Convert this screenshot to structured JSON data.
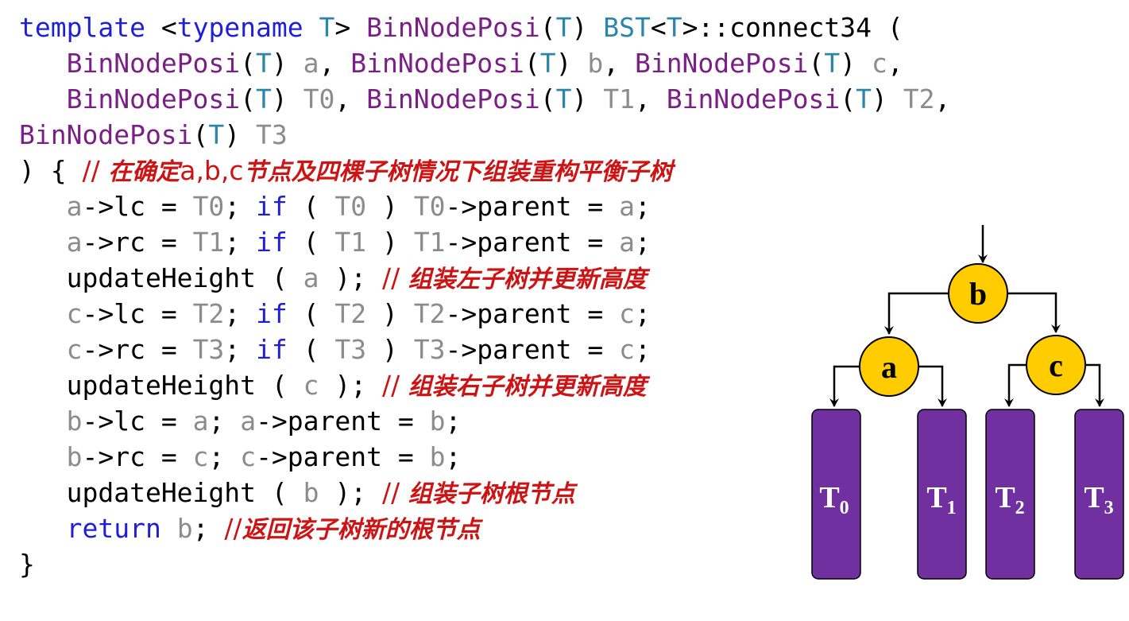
{
  "code": {
    "l1": {
      "kw_template": "template",
      "lt": " <",
      "kw_typename": "typename",
      "sp1": " ",
      "T1": "T",
      "gt": "> ",
      "binnodeposi": "BinNodePosi",
      "p_open": "(",
      "T2": "T",
      "p_close": ") ",
      "bst": "BST",
      "lt2": "<",
      "T3": "T",
      "rest": ">::connect34 ("
    },
    "l2": {
      "indent": "   ",
      "bnp1": "BinNodePosi",
      "po1": "(",
      "T1": "T",
      "pc1": ") ",
      "a": "a",
      "c1": ", ",
      "bnp2": "BinNodePosi",
      "po2": "(",
      "T2": "T",
      "pc2": ") ",
      "b": "b",
      "c2": ", ",
      "bnp3": "BinNodePosi",
      "po3": "(",
      "T3": "T",
      "pc3": ") ",
      "c": "c",
      "c3": ","
    },
    "l3": {
      "indent": "   ",
      "bnp1": "BinNodePosi",
      "po1": "(",
      "T1": "T",
      "pc1": ") ",
      "t0": "T0",
      "c1": ", ",
      "bnp2": "BinNodePosi",
      "po2": "(",
      "T2": "T",
      "pc2": ") ",
      "t1": "T1",
      "c2": ", ",
      "bnp3": "BinNodePosi",
      "po3": "(",
      "T3": "T",
      "pc3": ") ",
      "t2": "T2",
      "c3": ","
    },
    "l4": {
      "bnp": "BinNodePosi",
      "po": "(",
      "T": "T",
      "pc": ") ",
      "t3": "T3"
    },
    "l5": {
      "brace": ") { ",
      "comment_slash": "// ",
      "comment_cn1": "在确定",
      "comment_abc": "a,b,c",
      "comment_cn2": "节点及四棵子树情况下组装重构平衡子树"
    },
    "l6": {
      "indent": "   ",
      "a1": "a",
      "op": "->lc = ",
      "t0a": "T0",
      "semi": "; ",
      "kw_if": "if",
      "po": " ( ",
      "t0b": "T0",
      "pc": " ) ",
      "t0c": "T0",
      "assign": "->parent = ",
      "a2": "a",
      "end": ";"
    },
    "l7": {
      "indent": "   ",
      "a1": "a",
      "op": "->rc = ",
      "t1a": "T1",
      "semi": "; ",
      "kw_if": "if",
      "po": " ( ",
      "t1b": "T1",
      "pc": " ) ",
      "t1c": "T1",
      "assign": "->parent = ",
      "a2": "a",
      "end": ";"
    },
    "l8": {
      "indent": "   ",
      "fn": "updateHeight ( ",
      "a": "a",
      "close": " ); ",
      "slash": "// ",
      "comment": "组装左子树并更新高度"
    },
    "l9": {
      "indent": "   ",
      "c1": "c",
      "op": "->lc = ",
      "t2a": "T2",
      "semi": "; ",
      "kw_if": "if",
      "po": " ( ",
      "t2b": "T2",
      "pc": " ) ",
      "t2c": "T2",
      "assign": "->parent = ",
      "c2": "c",
      "end": ";"
    },
    "l10": {
      "indent": "   ",
      "c1": "c",
      "op": "->rc = ",
      "t3a": "T3",
      "semi": "; ",
      "kw_if": "if",
      "po": " ( ",
      "t3b": "T3",
      "pc": " ) ",
      "t3c": "T3",
      "assign": "->parent = ",
      "c2": "c",
      "end": ";"
    },
    "l11": {
      "indent": "   ",
      "fn": "updateHeight ( ",
      "c": "c",
      "close": " ); ",
      "slash": "// ",
      "comment": "组装右子树并更新高度"
    },
    "l12": {
      "indent": "   ",
      "b1": "b",
      "op": "->lc = ",
      "a1": "a",
      "semi": "; ",
      "a2": "a",
      "assign": "->parent = ",
      "b2": "b",
      "end": ";"
    },
    "l13": {
      "indent": "   ",
      "b1": "b",
      "op": "->rc = ",
      "c1": "c",
      "semi": "; ",
      "c2": "c",
      "assign": "->parent = ",
      "b2": "b",
      "end": ";"
    },
    "l14": {
      "indent": "   ",
      "fn": "updateHeight ( ",
      "b": "b",
      "close": " ); ",
      "slash": "// ",
      "comment": "组装子树根节点"
    },
    "l15": {
      "indent": "   ",
      "kw_return": "return",
      "sp": " ",
      "b": "b",
      "semi": "; ",
      "slash": "//",
      "comment": "返回该子树新的根节点"
    },
    "l16": {
      "brace": "}"
    }
  },
  "diagram": {
    "nodes": {
      "b": "b",
      "a": "a",
      "c": "c"
    },
    "subtrees": {
      "t0": {
        "main": "T",
        "sub": "0"
      },
      "t1": {
        "main": "T",
        "sub": "1"
      },
      "t2": {
        "main": "T",
        "sub": "2"
      },
      "t3": {
        "main": "T",
        "sub": "3"
      }
    },
    "colors": {
      "node_fill": "#ffcc00",
      "subtree_fill": "#7030a0",
      "subtree_text": "#ffffff",
      "edge": "#000000"
    }
  }
}
